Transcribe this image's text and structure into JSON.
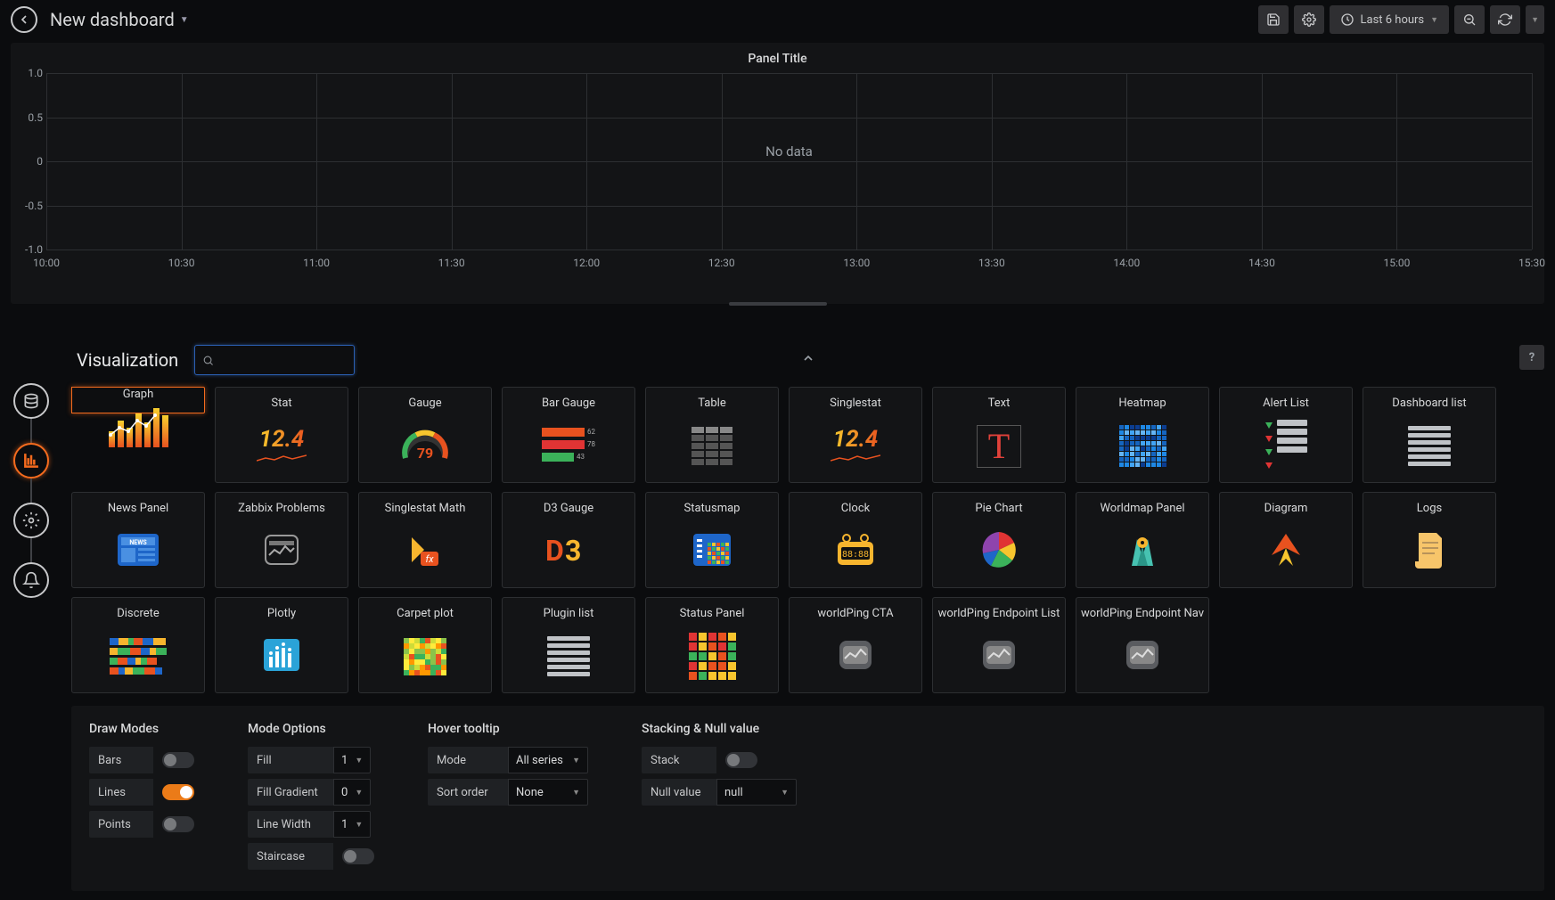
{
  "header": {
    "title": "New dashboard",
    "time_range": "Last 6 hours"
  },
  "panel": {
    "title": "Panel Title",
    "empty": "No data"
  },
  "chart_data": {
    "type": "line",
    "x": [
      "10:00",
      "10:30",
      "11:00",
      "11:30",
      "12:00",
      "12:30",
      "13:00",
      "13:30",
      "14:00",
      "14:30",
      "15:00",
      "15:30"
    ],
    "y_ticks": [
      "1.0",
      "0.5",
      "0",
      "-0.5",
      "-1.0"
    ],
    "ylim": [
      -1.0,
      1.0
    ],
    "series": [],
    "title": "Panel Title",
    "xlabel": "",
    "ylabel": ""
  },
  "sidenav": [
    "queries",
    "visualization",
    "general",
    "alert"
  ],
  "tab": {
    "title": "Visualization",
    "search_placeholder": ""
  },
  "viz": [
    {
      "k": "graph",
      "label": "Graph",
      "selected": true
    },
    {
      "k": "stat",
      "label": "Stat"
    },
    {
      "k": "gauge",
      "label": "Gauge"
    },
    {
      "k": "bargauge",
      "label": "Bar Gauge"
    },
    {
      "k": "table",
      "label": "Table"
    },
    {
      "k": "singlestat",
      "label": "Singlestat"
    },
    {
      "k": "text",
      "label": "Text"
    },
    {
      "k": "heatmap",
      "label": "Heatmap"
    },
    {
      "k": "alertlist",
      "label": "Alert List"
    },
    {
      "k": "dashlist",
      "label": "Dashboard list"
    },
    {
      "k": "news",
      "label": "News Panel"
    },
    {
      "k": "zabbix",
      "label": "Zabbix Problems"
    },
    {
      "k": "ssmath",
      "label": "Singlestat Math"
    },
    {
      "k": "d3gauge",
      "label": "D3 Gauge"
    },
    {
      "k": "statusmap",
      "label": "Statusmap"
    },
    {
      "k": "clock",
      "label": "Clock"
    },
    {
      "k": "pie",
      "label": "Pie Chart"
    },
    {
      "k": "worldmap",
      "label": "Worldmap Panel"
    },
    {
      "k": "diagram",
      "label": "Diagram"
    },
    {
      "k": "logs",
      "label": "Logs"
    },
    {
      "k": "discrete",
      "label": "Discrete"
    },
    {
      "k": "plotly",
      "label": "Plotly"
    },
    {
      "k": "carpet",
      "label": "Carpet plot"
    },
    {
      "k": "plugin",
      "label": "Plugin list"
    },
    {
      "k": "statuspanel",
      "label": "Status Panel"
    },
    {
      "k": "wpcta",
      "label": "worldPing CTA"
    },
    {
      "k": "wpel",
      "label": "worldPing Endpoint List"
    },
    {
      "k": "wpen",
      "label": "worldPing Endpoint Nav"
    }
  ],
  "opts": {
    "drawmodes": {
      "title": "Draw Modes",
      "bars": {
        "label": "Bars",
        "on": false
      },
      "lines": {
        "label": "Lines",
        "on": true
      },
      "points": {
        "label": "Points",
        "on": false
      }
    },
    "modeoptions": {
      "title": "Mode Options",
      "fill": {
        "label": "Fill",
        "value": "1"
      },
      "fillgrad": {
        "label": "Fill Gradient",
        "value": "0"
      },
      "linewidth": {
        "label": "Line Width",
        "value": "1"
      },
      "staircase": {
        "label": "Staircase",
        "on": false
      }
    },
    "hover": {
      "title": "Hover tooltip",
      "mode": {
        "label": "Mode",
        "value": "All series"
      },
      "sort": {
        "label": "Sort order",
        "value": "None"
      }
    },
    "stack": {
      "title": "Stacking & Null value",
      "stack": {
        "label": "Stack",
        "on": false
      },
      "nullv": {
        "label": "Null value",
        "value": "null"
      }
    }
  },
  "bargauge": {
    "v1": "62",
    "v2": "78",
    "v3": "43"
  },
  "gauge_value": "79",
  "stat_value": "12.4"
}
